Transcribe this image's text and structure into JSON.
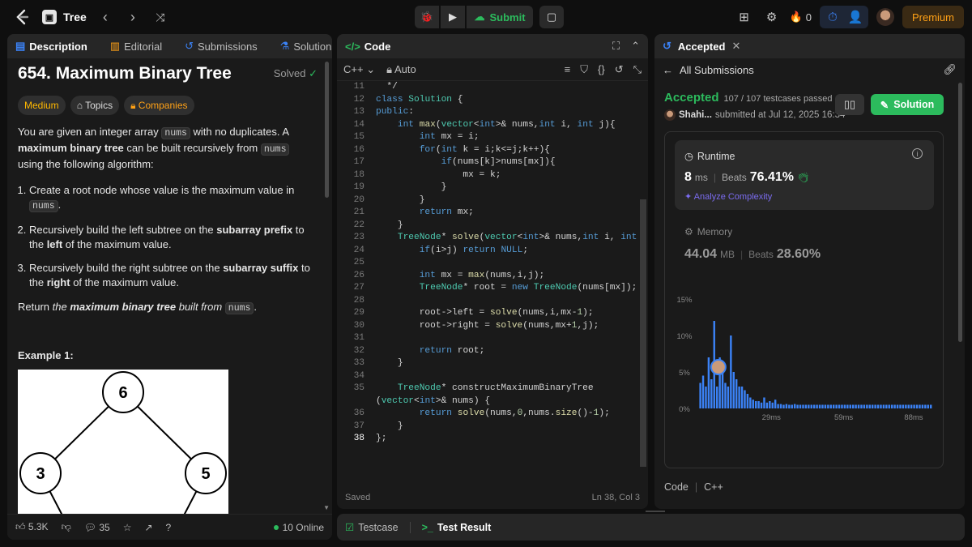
{
  "topbar": {
    "problem_list": "Tree",
    "submit_label": "Submit",
    "streak_count": "0",
    "premium_label": "Premium"
  },
  "left": {
    "tabs": [
      "Description",
      "Editorial",
      "Submissions",
      "Solutions"
    ],
    "title": "654. Maximum Binary Tree",
    "solved": "Solved",
    "tags": [
      "Medium",
      "Topics",
      "Companies"
    ],
    "intro_a": "You are given an integer array ",
    "intro_nums": "nums",
    "intro_b": " with no duplicates. A ",
    "intro_bold": "maximum binary tree",
    "intro_c": " can be built recursively from ",
    "intro_nums2": "nums",
    "intro_d": " using the following algorithm:",
    "steps": [
      {
        "a": "Create a root node whose value is the maximum value in ",
        "code": "nums",
        "b": "."
      },
      {
        "a": "Recursively build the left subtree on the ",
        "bold": "subarray prefix",
        "b": " to the ",
        "bold2": "left",
        "c": " of the maximum value."
      },
      {
        "a": "Recursively build the right subtree on the ",
        "bold": "subarray suffix",
        "b": " to the ",
        "bold2": "right",
        "c": " of the maximum value."
      }
    ],
    "return_a": "Return ",
    "return_b": "the ",
    "return_bold": "maximum binary tree",
    "return_c": " built from ",
    "return_code": "nums",
    "return_d": ".",
    "example_label": "Example 1:",
    "tree_nodes": [
      "6",
      "3",
      "5"
    ],
    "likes": "5.3K",
    "comments": "35",
    "online": "10 Online"
  },
  "code": {
    "tab": "Code",
    "language": "C++",
    "mode": "Auto",
    "status": "Saved",
    "cursor": "Ln 38, Col 3",
    "lines": [
      {
        "n": "11",
        "t": "  */"
      },
      {
        "n": "12",
        "t": "class Solution {"
      },
      {
        "n": "13",
        "t": "public:"
      },
      {
        "n": "14",
        "t": "    int max(vector<int>& nums,int i, int j){"
      },
      {
        "n": "15",
        "t": "        int mx = i;"
      },
      {
        "n": "16",
        "t": "        for(int k = i;k<=j;k++){"
      },
      {
        "n": "17",
        "t": "            if(nums[k]>nums[mx]){"
      },
      {
        "n": "18",
        "t": "                mx = k;"
      },
      {
        "n": "19",
        "t": "            }"
      },
      {
        "n": "20",
        "t": "        }"
      },
      {
        "n": "21",
        "t": "        return mx;"
      },
      {
        "n": "22",
        "t": "    }"
      },
      {
        "n": "23",
        "t": "    TreeNode* solve(vector<int>& nums,int i, int j){"
      },
      {
        "n": "24",
        "t": "        if(i>j) return NULL;"
      },
      {
        "n": "25",
        "t": ""
      },
      {
        "n": "26",
        "t": "        int mx = max(nums,i,j);"
      },
      {
        "n": "27",
        "t": "        TreeNode* root = new TreeNode(nums[mx]);"
      },
      {
        "n": "28",
        "t": ""
      },
      {
        "n": "29",
        "t": "        root->left = solve(nums,i,mx-1);"
      },
      {
        "n": "30",
        "t": "        root->right = solve(nums,mx+1,j);"
      },
      {
        "n": "31",
        "t": ""
      },
      {
        "n": "32",
        "t": "        return root;"
      },
      {
        "n": "33",
        "t": "    }"
      },
      {
        "n": "34",
        "t": ""
      },
      {
        "n": "35",
        "t": "    TreeNode* constructMaximumBinaryTree"
      },
      {
        "n": "",
        "t": "(vector<int>& nums) {"
      },
      {
        "n": "36",
        "t": "        return solve(nums,0,nums.size()-1);"
      },
      {
        "n": "37",
        "t": "    }"
      },
      {
        "n": "38",
        "t": "};"
      }
    ]
  },
  "tests": {
    "tabs": [
      "Testcase",
      "Test Result"
    ]
  },
  "right": {
    "tab": "Accepted",
    "back_label": "All Submissions",
    "status": "Accepted",
    "passed": "107 / 107 testcases passed",
    "user": "Shahi...",
    "submitted": "submitted at Jul 12, 2025 16:34",
    "solution_btn": "Solution",
    "runtime_label": "Runtime",
    "runtime_value": "8",
    "runtime_unit": "ms",
    "beats_label": "Beats",
    "runtime_beats": "76.41%",
    "analyze": "Analyze Complexity",
    "memory_label": "Memory",
    "memory_value": "44.04",
    "memory_unit": "MB",
    "memory_beats": "28.60%",
    "code_label": "Code",
    "code_lang": "C++"
  },
  "chart_data": {
    "type": "bar",
    "title": "",
    "xlabel": "",
    "ylabel": "",
    "y_ticks": [
      "15%",
      "10%",
      "5%",
      "0%"
    ],
    "x_ticks": [
      "29ms",
      "59ms",
      "88ms"
    ],
    "ylim": [
      0,
      15
    ],
    "highlight_runtime_ms": 8,
    "values": [
      3.5,
      4.5,
      3,
      7,
      4,
      12,
      3,
      7,
      6,
      3.5,
      3,
      10,
      5,
      4,
      3,
      3,
      2.5,
      2,
      1.5,
      1.2,
      1,
      1,
      0.8,
      1.5,
      0.8,
      1,
      0.8,
      1.2,
      0.6,
      0.6,
      0.5,
      0.6,
      0.5,
      0.5,
      0.6,
      0.5,
      0.5,
      0.5,
      0.5,
      0.5,
      0.5,
      0.5,
      0.5,
      0.5,
      0.5,
      0.5,
      0.5,
      0.5,
      0.5,
      0.5,
      0.5,
      0.5,
      0.5,
      0.5,
      0.5,
      0.5,
      0.5,
      0.5,
      0.5,
      0.5,
      0.5,
      0.5,
      0.5,
      0.5,
      0.5,
      0.5,
      0.5,
      0.5,
      0.5,
      0.5,
      0.5,
      0.5,
      0.5,
      0.5,
      0.5,
      0.5,
      0.5,
      0.5,
      0.5,
      0.5,
      0.5,
      0.5,
      0.5,
      0.5
    ]
  }
}
